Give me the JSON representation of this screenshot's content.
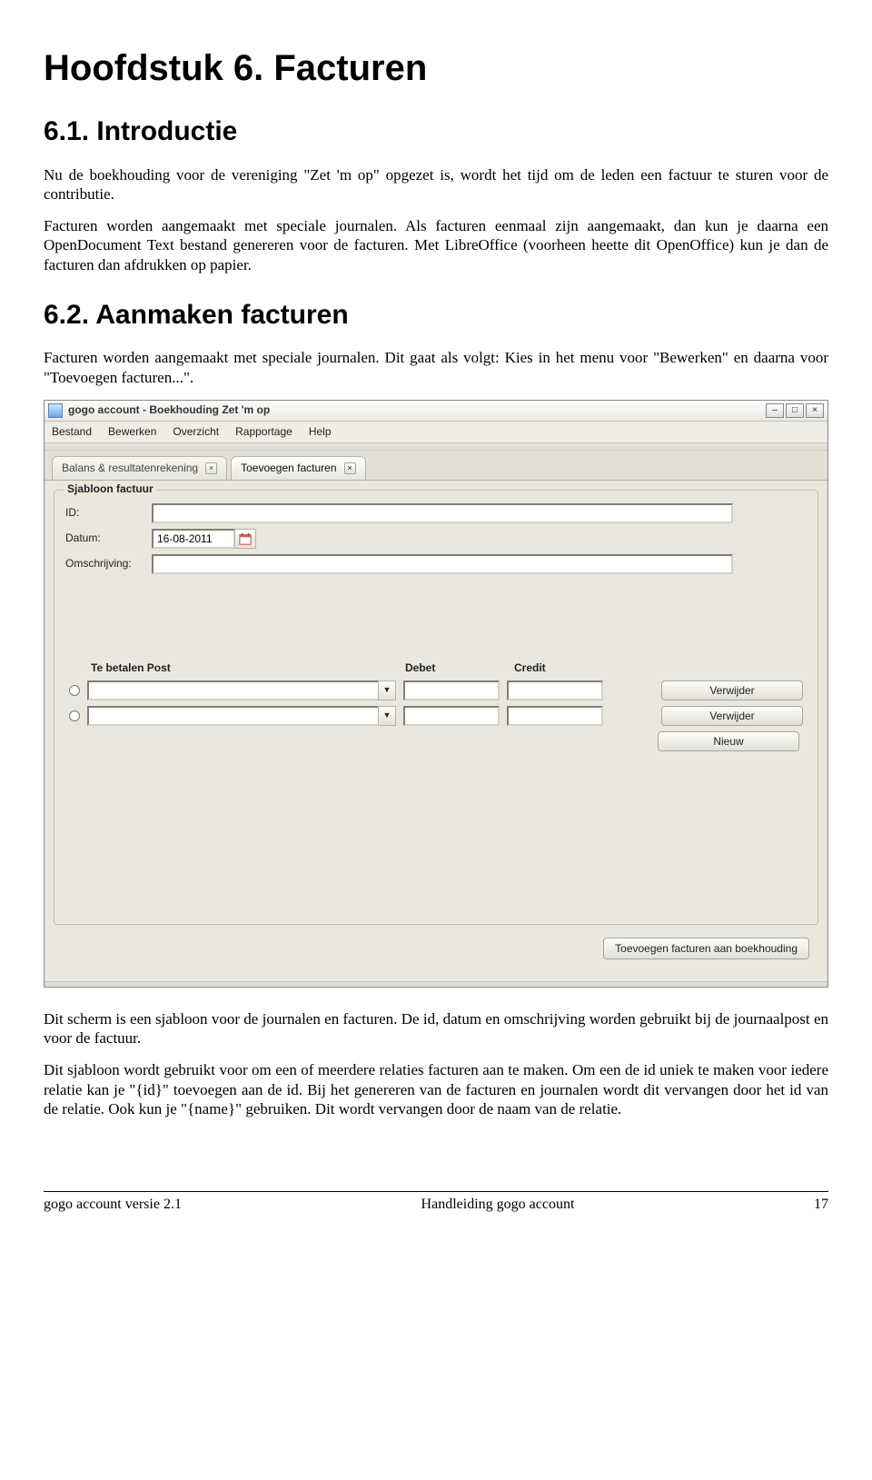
{
  "doc": {
    "h1": "Hoofdstuk 6. Facturen",
    "s1_title": "6.1. Introductie",
    "s1_p1": "Nu de boekhouding voor de vereniging \"Zet 'm op\" opgezet is, wordt het tijd om de leden een factuur te sturen voor de contributie.",
    "s1_p2": "Facturen worden aangemaakt met speciale journalen. Als facturen eenmaal zijn aangemaakt, dan kun je daarna een OpenDocument Text bestand genereren voor de facturen. Met LibreOffice (voorheen heette dit OpenOffice) kun je dan de facturen dan afdrukken op papier.",
    "s2_title": "6.2. Aanmaken facturen",
    "s2_p1": "Facturen worden aangemaakt met speciale journalen. Dit gaat als volgt: Kies in het menu voor \"Bewerken\" en daarna voor \"Toevoegen facturen...\".",
    "after_p1": "Dit scherm is een sjabloon voor de journalen en facturen. De id, datum en omschrijving worden gebruikt bij de journaalpost en voor de factuur.",
    "after_p2": "Dit sjabloon wordt gebruikt voor om een of meerdere relaties facturen aan te maken. Om een de id uniek te maken voor iedere relatie kan je \"{id}\" toevoegen aan de id. Bij het genereren van de facturen en journalen wordt dit vervangen door het id van de relatie. Ook kun je \"{name}\" gebruiken. Dit wordt vervangen door de naam van de relatie."
  },
  "app": {
    "title": "gogo account - Boekhouding Zet 'm op",
    "menus": [
      "Bestand",
      "Bewerken",
      "Overzicht",
      "Rapportage",
      "Help"
    ],
    "tabs": [
      {
        "label": "Balans & resultatenrekening",
        "active": false
      },
      {
        "label": "Toevoegen facturen",
        "active": true
      }
    ],
    "group_title": "Sjabloon factuur",
    "labels": {
      "id": "ID:",
      "datum": "Datum:",
      "omschrijving": "Omschrijving:"
    },
    "values": {
      "id": "",
      "datum": "16-08-2011",
      "omschrijving": ""
    },
    "columns": {
      "post": "Te betalen Post",
      "debet": "Debet",
      "credit": "Credit"
    },
    "buttons": {
      "verwijder": "Verwijder",
      "nieuw": "Nieuw",
      "submit": "Toevoegen facturen aan boekhouding"
    },
    "rows": [
      {
        "post": "",
        "debet": "",
        "credit": ""
      },
      {
        "post": "",
        "debet": "",
        "credit": ""
      }
    ]
  },
  "footer": {
    "left": "gogo account versie 2.1",
    "center": "Handleiding gogo account",
    "right": "17"
  }
}
